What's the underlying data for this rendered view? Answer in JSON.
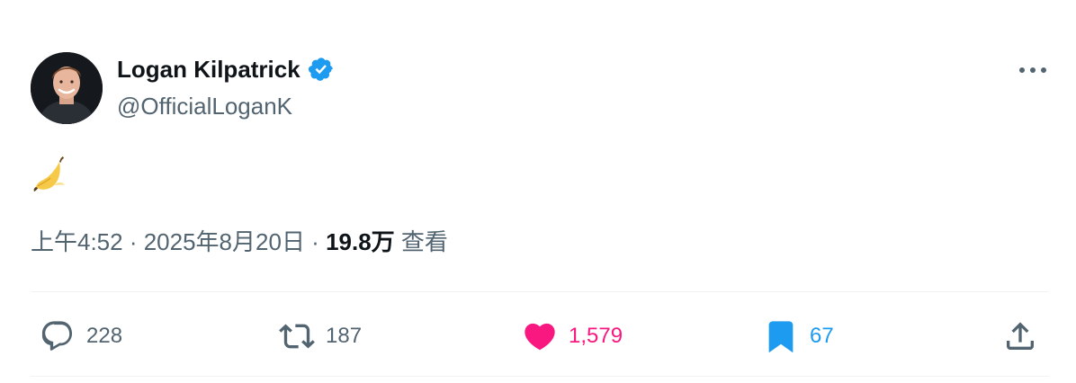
{
  "author": {
    "display_name": "Logan Kilpatrick",
    "handle": "@OfficialLoganK",
    "verified": true
  },
  "tweet": {
    "content_icon": "banana-emoji"
  },
  "meta": {
    "time": "上午4:52",
    "separator": " · ",
    "date": "2025年8月20日",
    "views_count": "19.8万",
    "views_label": " 查看"
  },
  "actions": {
    "reply_count": "228",
    "retweet_count": "187",
    "like_count": "1,579",
    "bookmark_count": "67"
  },
  "colors": {
    "text": "#0f1419",
    "secondary_text": "#536471",
    "like": "#f91880",
    "bookmark": "#1d9bf0",
    "verified": "#1d9bf0",
    "divider": "#eff3f4"
  }
}
